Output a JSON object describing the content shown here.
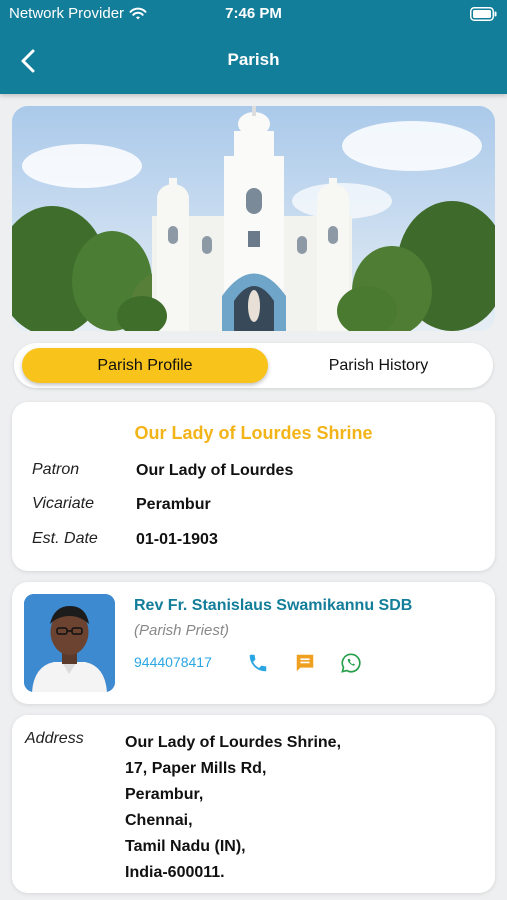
{
  "status_bar": {
    "carrier": "Network Provider",
    "time": "7:46 PM"
  },
  "header": {
    "title": "Parish"
  },
  "tabs": [
    {
      "label": "Parish Profile",
      "active": true
    },
    {
      "label": "Parish History",
      "active": false
    }
  ],
  "profile": {
    "name": "Our Lady of Lourdes Shrine",
    "fields": [
      {
        "label": "Patron",
        "value": "Our Lady of Lourdes"
      },
      {
        "label": "Vicariate",
        "value": "Perambur"
      },
      {
        "label": "Est. Date",
        "value": "01-01-1903"
      }
    ]
  },
  "priest": {
    "name": "Rev Fr. Stanislaus Swamikannu SDB",
    "role": "(Parish Priest)",
    "phone": "9444078417"
  },
  "address": {
    "label": "Address",
    "lines": [
      "Our Lady of Lourdes Shrine,",
      "17, Paper Mills Rd,",
      "Perambur,",
      "Chennai,",
      "Tamil Nadu (IN),",
      "India-600011."
    ]
  },
  "colors": {
    "header": "#137e9a",
    "accent_yellow": "#f8c31b",
    "title_yellow": "#f2b418",
    "priest_teal": "#137e9a",
    "phone_blue": "#2aa6e3",
    "message_orange": "#f0a020",
    "whatsapp_green": "#26a04a"
  }
}
